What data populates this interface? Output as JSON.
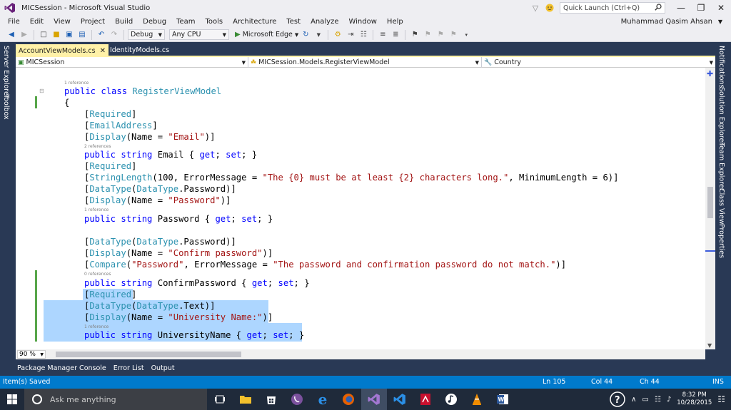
{
  "window": {
    "title": "MICSession - Microsoft Visual Studio",
    "quick_launch_placeholder": "Quick Launch (Ctrl+Q)"
  },
  "menu": [
    "File",
    "Edit",
    "View",
    "Project",
    "Build",
    "Debug",
    "Team",
    "Tools",
    "Architecture",
    "Test",
    "Analyze",
    "Window",
    "Help"
  ],
  "user_name": "Muhammad Qasim Ahsan",
  "toolbar": {
    "config": "Debug",
    "platform": "Any CPU",
    "run_target": "Microsoft Edge"
  },
  "left_strip": [
    "Server Explorer",
    "Toolbox"
  ],
  "right_strip": [
    "Notifications",
    "Solution Explorer",
    "Team Explorer",
    "Class View",
    "Properties"
  ],
  "tabs": {
    "active": "AccountViewModels.cs",
    "inactive": "IdentityModels.cs"
  },
  "navbar": {
    "project": "MICSession",
    "class": "MICSession.Models.RegisterViewModel",
    "member": "Country"
  },
  "code": {
    "refs": [
      "1 reference",
      "2 references",
      "1 reference",
      "0 references",
      "1 reference"
    ],
    "lines": {
      "l1_a": "public class ",
      "l1_b": "RegisterViewModel",
      "l2": "{",
      "l3": "Required",
      "l4": "EmailAddress",
      "l5_a": "Display",
      "l5_b": "(Name = ",
      "l5_c": "\"Email\"",
      "l6_a": "public string ",
      "l6_b": "Email { ",
      "l6_c": "get",
      "l6_d": "; ",
      "l6_e": "set",
      "l6_f": "; }",
      "l7": "Required",
      "l8_a": "StringLength",
      "l8_b": "(100, ErrorMessage = ",
      "l8_c": "\"The {0} must be at least {2} characters long.\"",
      "l8_d": ", MinimumLength = 6)]",
      "l9_a": "DataType",
      "l9_b": "(",
      "l9_c": "DataType",
      "l9_d": ".Password)]",
      "l10_a": "Display",
      "l10_b": "(Name = ",
      "l10_c": "\"Password\"",
      "l11_b": "Password { ",
      "l12_a": "DataType",
      "l12_c": "DataType",
      "l12_d": ".Password)]",
      "l13_a": "Display",
      "l13_b": "(Name = ",
      "l13_c": "\"Confirm password\"",
      "l14_a": "Compare",
      "l14_b": "(",
      "l14_c": "\"Password\"",
      "l14_d": ", ErrorMessage = ",
      "l14_e": "\"The password and confirmation password do not match.\"",
      "l14_f": ")]",
      "l15_b": "ConfirmPassword { ",
      "l16": "Required",
      "l17_a": "DataType",
      "l17_c": "DataType",
      "l17_d": ".Text)]",
      "l18_a": "Display",
      "l18_b": "(Name = ",
      "l18_c": "\"University Name:\"",
      "l19_b": "UniversityName { "
    }
  },
  "zoom": "90 %",
  "bottom_tabs": [
    "Package Manager Console",
    "Error List",
    "Output"
  ],
  "status": {
    "message": "Item(s) Saved",
    "ln": "Ln 105",
    "col": "Col 44",
    "ch": "Ch 44",
    "mode": "INS"
  },
  "taskbar": {
    "search_placeholder": "Ask me anything",
    "time": "8:32 PM",
    "date": "10/28/2015"
  },
  "colors": {
    "keyword": "#0000ff",
    "type": "#2b91af",
    "string": "#a31515",
    "selection": "#add6ff",
    "status_bar": "#007acc",
    "active_tab": "#fff1a8"
  }
}
